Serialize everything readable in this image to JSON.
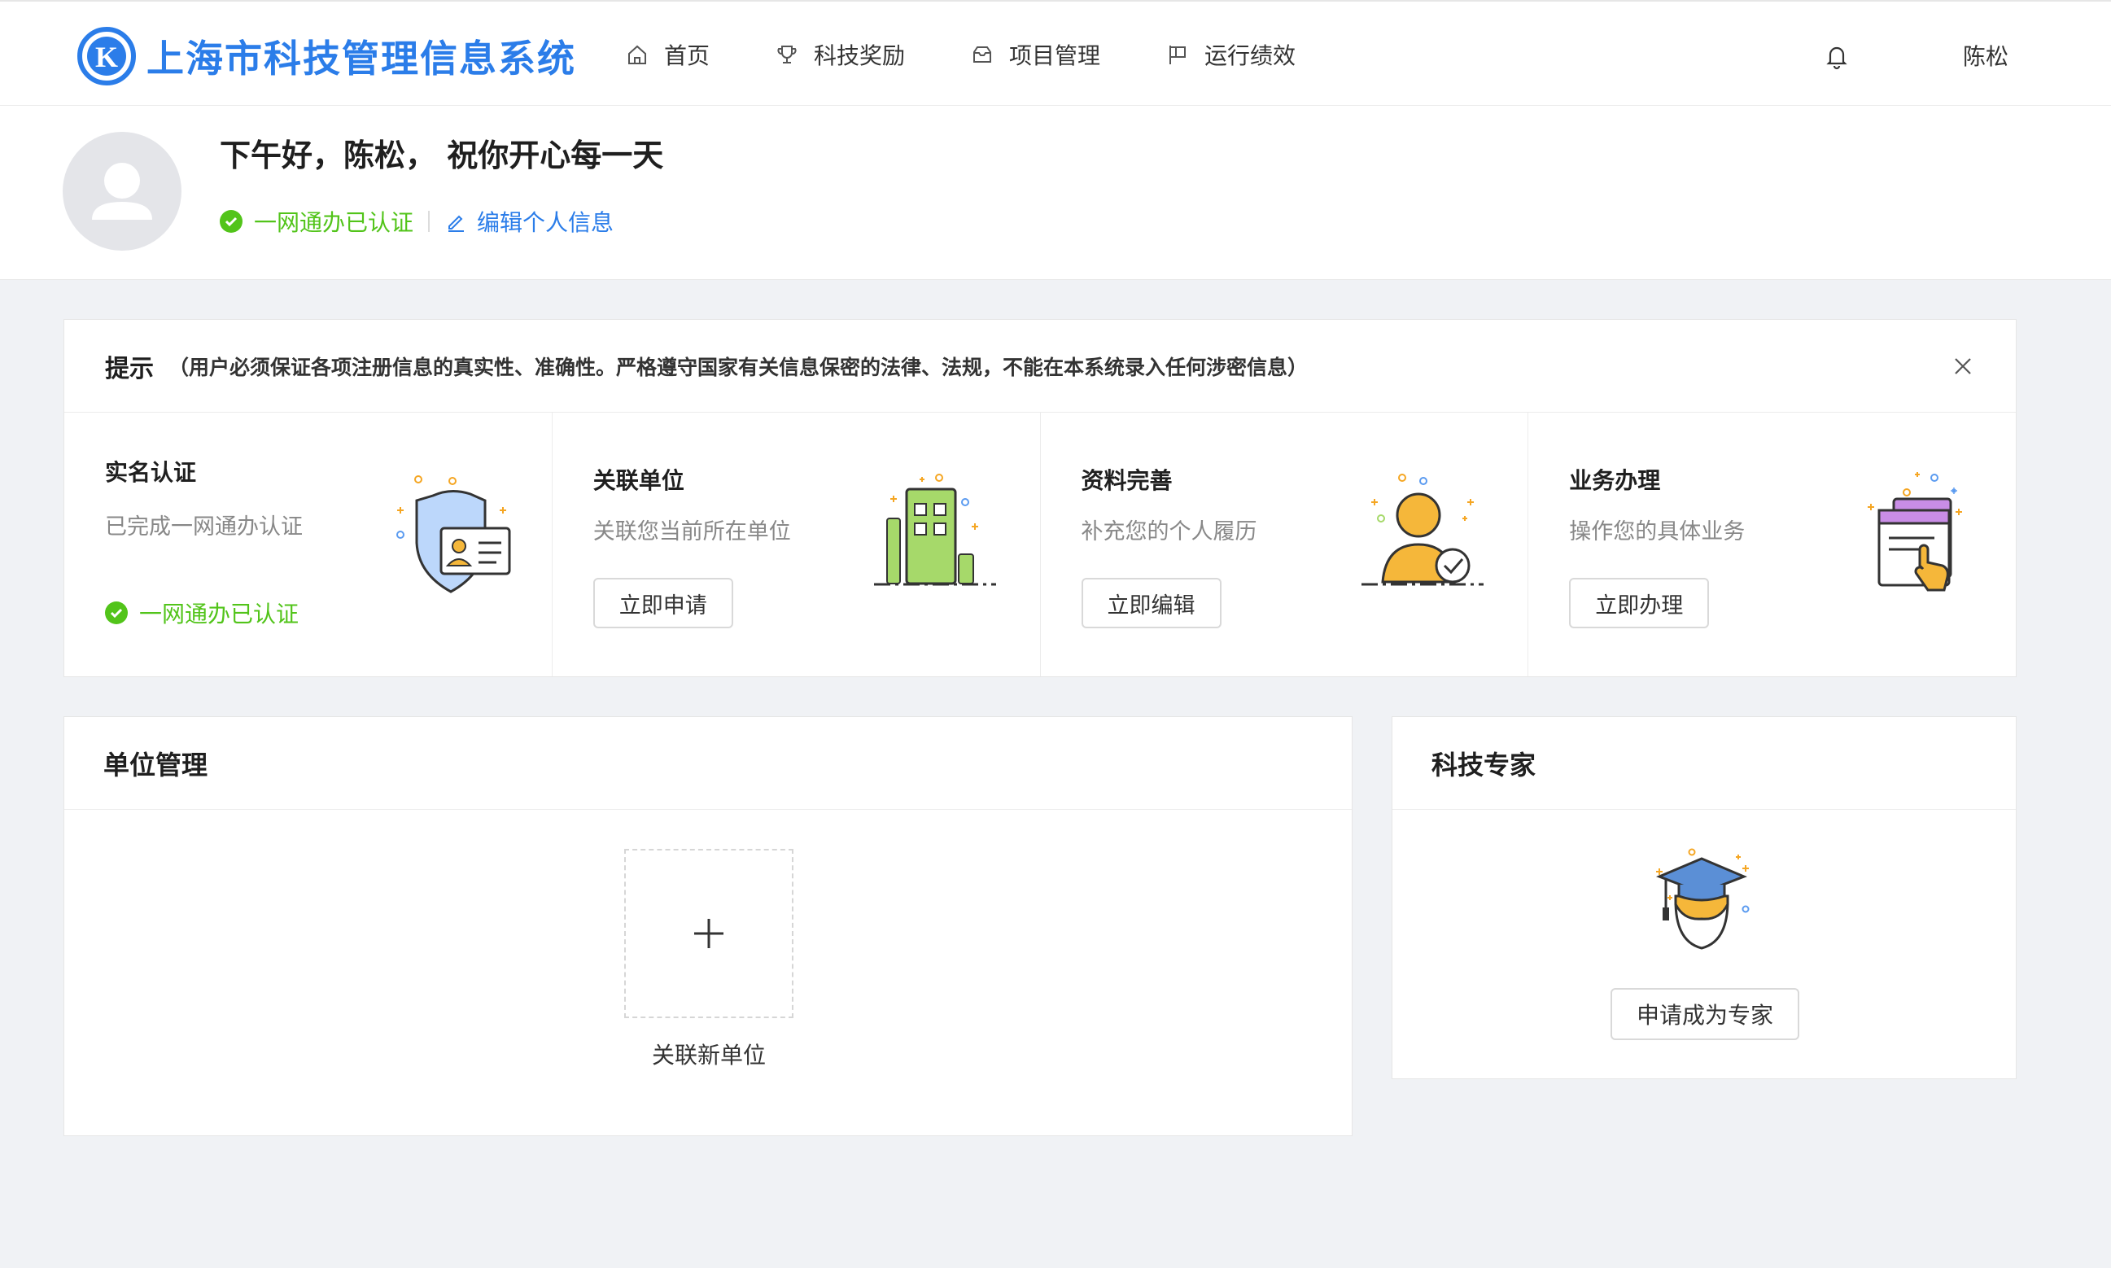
{
  "app": {
    "logo_letter": "K",
    "title": "上海市科技管理信息系统"
  },
  "nav": {
    "items": [
      {
        "label": "首页",
        "icon": "home-icon"
      },
      {
        "label": "科技奖励",
        "icon": "trophy-icon"
      },
      {
        "label": "项目管理",
        "icon": "inbox-icon"
      },
      {
        "label": "运行绩效",
        "icon": "flag-icon"
      }
    ],
    "bell_icon": "bell-icon",
    "user_name": "陈松"
  },
  "profile": {
    "greeting": "下午好，陈松， 祝你开心每一天",
    "verified_label": "一网通办已认证",
    "edit_label": "编辑个人信息"
  },
  "notice": {
    "title": "提示",
    "text": "（用户必须保证各项注册信息的真实性、准确性。严格遵守国家有关信息保密的法律、法规，不能在本系统录入任何涉密信息）"
  },
  "steps": [
    {
      "title": "实名认证",
      "desc": "已完成一网通办认证",
      "status": "一网通办已认证",
      "icon": "id-shield-illustration"
    },
    {
      "title": "关联单位",
      "desc": "关联您当前所在单位",
      "button": "立即申请",
      "icon": "building-illustration"
    },
    {
      "title": "资料完善",
      "desc": "补充您的个人履历",
      "button": "立即编辑",
      "icon": "user-check-illustration"
    },
    {
      "title": "业务办理",
      "desc": "操作您的具体业务",
      "button": "立即办理",
      "icon": "hand-click-illustration"
    }
  ],
  "unit_panel": {
    "title": "单位管理",
    "add_label": "关联新单位"
  },
  "expert_panel": {
    "title": "科技专家",
    "button": "申请成为专家"
  },
  "colors": {
    "brand": "#2b7de9",
    "success": "#52c41a",
    "background": "#f0f2f5"
  }
}
